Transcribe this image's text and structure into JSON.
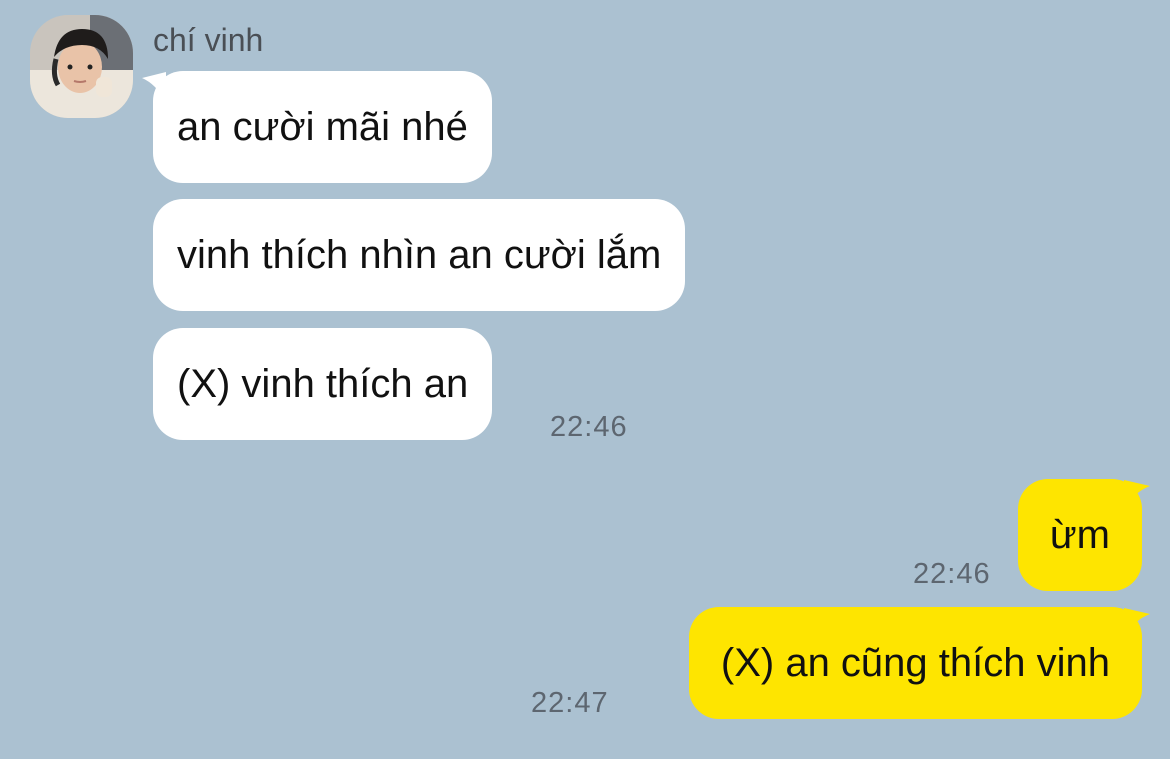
{
  "chat": {
    "sender_name": "chí vinh",
    "incoming": [
      {
        "text": "an cười mãi nhé"
      },
      {
        "text": "vinh thích nhìn an cười lắm"
      },
      {
        "text": "(X) vinh thích an",
        "time": "22:46"
      }
    ],
    "outgoing": [
      {
        "text": "ừm",
        "time": "22:46"
      },
      {
        "text": "(X) an cũng thích vinh",
        "time": "22:47"
      }
    ]
  },
  "colors": {
    "background": "#abc1d1",
    "incoming_bubble": "#ffffff",
    "outgoing_bubble": "#fee500",
    "timestamp": "#5d6670",
    "sender_name": "#4a4f55"
  }
}
